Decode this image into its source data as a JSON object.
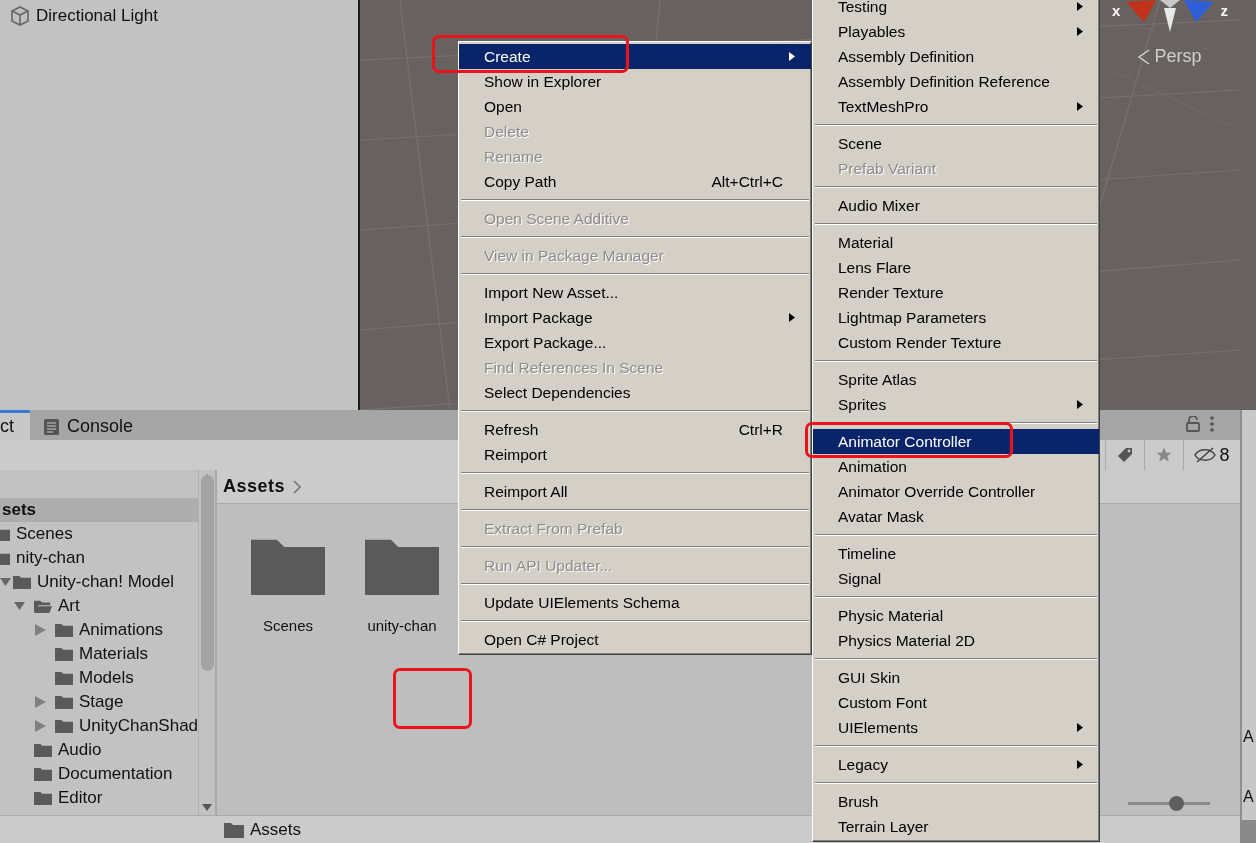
{
  "hierarchy": {
    "items": [
      {
        "label": "Directional Light"
      }
    ]
  },
  "scene_view": {
    "axis_labels": [
      "x",
      "z"
    ],
    "projection": "Persp"
  },
  "project_panel": {
    "tabs": [
      {
        "label": "ct",
        "selected": true,
        "kind": "project"
      },
      {
        "label": "Console",
        "selected": false,
        "kind": "console"
      }
    ],
    "toolbar": {
      "hidden_count": "8"
    },
    "tree": [
      {
        "label": "sets",
        "selected": true,
        "children": [
          {
            "label": "Scenes",
            "selected": false
          },
          {
            "label": "nity-chan",
            "selected": false,
            "children": [
              {
                "label": "Unity-chan! Model",
                "selected": false,
                "expanded": true,
                "children": [
                  {
                    "label": "Art",
                    "selected": false,
                    "expanded": true,
                    "children": [
                      {
                        "label": "Animations",
                        "selected": false,
                        "expanded": false
                      },
                      {
                        "label": "Materials",
                        "selected": false
                      },
                      {
                        "label": "Models",
                        "selected": false
                      },
                      {
                        "label": "Stage",
                        "selected": false,
                        "expanded": false
                      },
                      {
                        "label": "UnityChanShad",
                        "selected": false,
                        "expanded": false
                      }
                    ]
                  },
                  {
                    "label": "Audio",
                    "selected": false
                  },
                  {
                    "label": "Documentation",
                    "selected": false
                  },
                  {
                    "label": "Editor",
                    "selected": false
                  }
                ]
              }
            ]
          }
        ]
      }
    ],
    "breadcrumb": "Assets",
    "folders": [
      {
        "label": "Scenes"
      },
      {
        "label": "unity-chan"
      }
    ],
    "path": "Assets",
    "zoom_slider": {
      "level": 0.59
    }
  },
  "side_panel": {
    "texts": [
      "A",
      "A"
    ]
  },
  "menus": [
    {
      "items": [
        {
          "kind": "item",
          "label": "Create",
          "selected": true,
          "disabled": false,
          "submenu": true
        },
        {
          "kind": "item",
          "label": "Show in Explorer",
          "selected": false,
          "disabled": false,
          "submenu": false
        },
        {
          "kind": "item",
          "label": "Open",
          "selected": false,
          "disabled": false,
          "submenu": false
        },
        {
          "kind": "item",
          "label": "Delete",
          "selected": false,
          "disabled": true,
          "submenu": false
        },
        {
          "kind": "item",
          "label": "Rename",
          "selected": false,
          "disabled": true,
          "submenu": false
        },
        {
          "kind": "item",
          "label": "Copy Path",
          "shortcut": "Alt+Ctrl+C",
          "selected": false,
          "disabled": false,
          "submenu": false
        },
        {
          "kind": "separator"
        },
        {
          "kind": "item",
          "label": "Open Scene Additive",
          "selected": false,
          "disabled": true,
          "submenu": false
        },
        {
          "kind": "separator"
        },
        {
          "kind": "item",
          "label": "View in Package Manager",
          "selected": false,
          "disabled": true,
          "submenu": false
        },
        {
          "kind": "separator"
        },
        {
          "kind": "item",
          "label": "Import New Asset...",
          "selected": false,
          "disabled": false,
          "submenu": false
        },
        {
          "kind": "item",
          "label": "Import Package",
          "selected": false,
          "disabled": false,
          "submenu": true
        },
        {
          "kind": "item",
          "label": "Export Package...",
          "selected": false,
          "disabled": false,
          "submenu": false
        },
        {
          "kind": "item",
          "label": "Find References In Scene",
          "selected": false,
          "disabled": true,
          "submenu": false
        },
        {
          "kind": "item",
          "label": "Select Dependencies",
          "selected": false,
          "disabled": false,
          "submenu": false
        },
        {
          "kind": "separator"
        },
        {
          "kind": "item",
          "label": "Refresh",
          "shortcut": "Ctrl+R",
          "selected": false,
          "disabled": false,
          "submenu": false
        },
        {
          "kind": "item",
          "label": "Reimport",
          "selected": false,
          "disabled": false,
          "submenu": false
        },
        {
          "kind": "separator"
        },
        {
          "kind": "item",
          "label": "Reimport All",
          "selected": false,
          "disabled": false,
          "submenu": false
        },
        {
          "kind": "separator"
        },
        {
          "kind": "item",
          "label": "Extract From Prefab",
          "selected": false,
          "disabled": true,
          "submenu": false
        },
        {
          "kind": "separator"
        },
        {
          "kind": "item",
          "label": "Run API Updater...",
          "selected": false,
          "disabled": true,
          "submenu": false
        },
        {
          "kind": "separator"
        },
        {
          "kind": "item",
          "label": "Update UIElements Schema",
          "selected": false,
          "disabled": false,
          "submenu": false
        },
        {
          "kind": "separator"
        },
        {
          "kind": "item",
          "label": "Open C# Project",
          "selected": false,
          "disabled": false,
          "submenu": false
        }
      ]
    },
    {
      "items": [
        {
          "kind": "item",
          "label": "Testing",
          "selected": false,
          "disabled": false,
          "submenu": true
        },
        {
          "kind": "item",
          "label": "Playables",
          "selected": false,
          "disabled": false,
          "submenu": true
        },
        {
          "kind": "item",
          "label": "Assembly Definition",
          "selected": false,
          "disabled": false,
          "submenu": false
        },
        {
          "kind": "item",
          "label": "Assembly Definition Reference",
          "selected": false,
          "disabled": false,
          "submenu": false
        },
        {
          "kind": "item",
          "label": "TextMeshPro",
          "selected": false,
          "disabled": false,
          "submenu": true
        },
        {
          "kind": "separator"
        },
        {
          "kind": "item",
          "label": "Scene",
          "selected": false,
          "disabled": false,
          "submenu": false
        },
        {
          "kind": "item",
          "label": "Prefab Variant",
          "selected": false,
          "disabled": true,
          "submenu": false
        },
        {
          "kind": "separator"
        },
        {
          "kind": "item",
          "label": "Audio Mixer",
          "selected": false,
          "disabled": false,
          "submenu": false
        },
        {
          "kind": "separator"
        },
        {
          "kind": "item",
          "label": "Material",
          "selected": false,
          "disabled": false,
          "submenu": false
        },
        {
          "kind": "item",
          "label": "Lens Flare",
          "selected": false,
          "disabled": false,
          "submenu": false
        },
        {
          "kind": "item",
          "label": "Render Texture",
          "selected": false,
          "disabled": false,
          "submenu": false
        },
        {
          "kind": "item",
          "label": "Lightmap Parameters",
          "selected": false,
          "disabled": false,
          "submenu": false
        },
        {
          "kind": "item",
          "label": "Custom Render Texture",
          "selected": false,
          "disabled": false,
          "submenu": false
        },
        {
          "kind": "separator"
        },
        {
          "kind": "item",
          "label": "Sprite Atlas",
          "selected": false,
          "disabled": false,
          "submenu": false
        },
        {
          "kind": "item",
          "label": "Sprites",
          "selected": false,
          "disabled": false,
          "submenu": true
        },
        {
          "kind": "separator"
        },
        {
          "kind": "item",
          "label": "Animator Controller",
          "selected": true,
          "disabled": false,
          "submenu": false
        },
        {
          "kind": "item",
          "label": "Animation",
          "selected": false,
          "disabled": false,
          "submenu": false
        },
        {
          "kind": "item",
          "label": "Animator Override Controller",
          "selected": false,
          "disabled": false,
          "submenu": false
        },
        {
          "kind": "item",
          "label": "Avatar Mask",
          "selected": false,
          "disabled": false,
          "submenu": false
        },
        {
          "kind": "separator"
        },
        {
          "kind": "item",
          "label": "Timeline",
          "selected": false,
          "disabled": false,
          "submenu": false
        },
        {
          "kind": "item",
          "label": "Signal",
          "selected": false,
          "disabled": false,
          "submenu": false
        },
        {
          "kind": "separator"
        },
        {
          "kind": "item",
          "label": "Physic Material",
          "selected": false,
          "disabled": false,
          "submenu": false
        },
        {
          "kind": "item",
          "label": "Physics Material 2D",
          "selected": false,
          "disabled": false,
          "submenu": false
        },
        {
          "kind": "separator"
        },
        {
          "kind": "item",
          "label": "GUI Skin",
          "selected": false,
          "disabled": false,
          "submenu": false
        },
        {
          "kind": "item",
          "label": "Custom Font",
          "selected": false,
          "disabled": false,
          "submenu": false
        },
        {
          "kind": "item",
          "label": "UIElements",
          "selected": false,
          "disabled": false,
          "submenu": true
        },
        {
          "kind": "separator"
        },
        {
          "kind": "item",
          "label": "Legacy",
          "selected": false,
          "disabled": false,
          "submenu": true
        },
        {
          "kind": "separator"
        },
        {
          "kind": "item",
          "label": "Brush",
          "selected": false,
          "disabled": false,
          "submenu": false
        },
        {
          "kind": "item",
          "label": "Terrain Layer",
          "selected": false,
          "disabled": false,
          "submenu": false
        }
      ]
    }
  ]
}
